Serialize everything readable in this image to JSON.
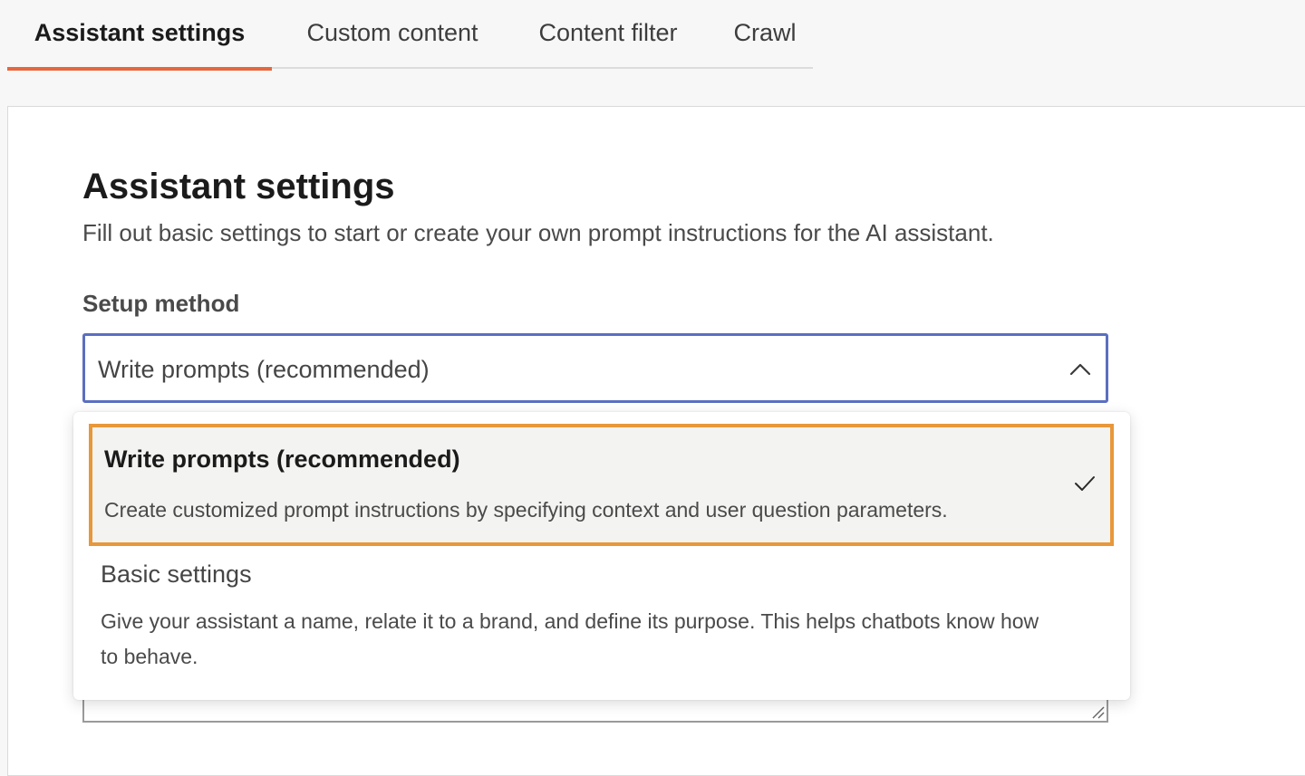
{
  "tabs": [
    {
      "label": "Assistant settings",
      "active": true
    },
    {
      "label": "Custom content",
      "active": false
    },
    {
      "label": "Content filter",
      "active": false
    },
    {
      "label": "Crawl",
      "active": false
    }
  ],
  "panel": {
    "title": "Assistant settings",
    "subtitle": "Fill out basic settings to start or create your own prompt instructions for the AI assistant.",
    "setup_method": {
      "label": "Setup method",
      "selected_value": "Write prompts (recommended)",
      "state": "expanded",
      "options": [
        {
          "title": "Write prompts (recommended)",
          "description": "Create customized prompt instructions by specifying context and user question parameters.",
          "selected": true
        },
        {
          "title": "Basic settings",
          "description": "Give your assistant a name, relate it to a brand, and define its purpose. This helps chatbots know how to behave.",
          "selected": false
        }
      ]
    }
  },
  "icons": {
    "dropdown": "chevron-up-icon",
    "selected_option": "check-icon",
    "textarea_corner": "resize-handle-icon"
  },
  "colors": {
    "active_tab_underline": "#e8663d",
    "select_focus_border": "#5b6fc0",
    "option_highlight_border": "#e8973a"
  }
}
